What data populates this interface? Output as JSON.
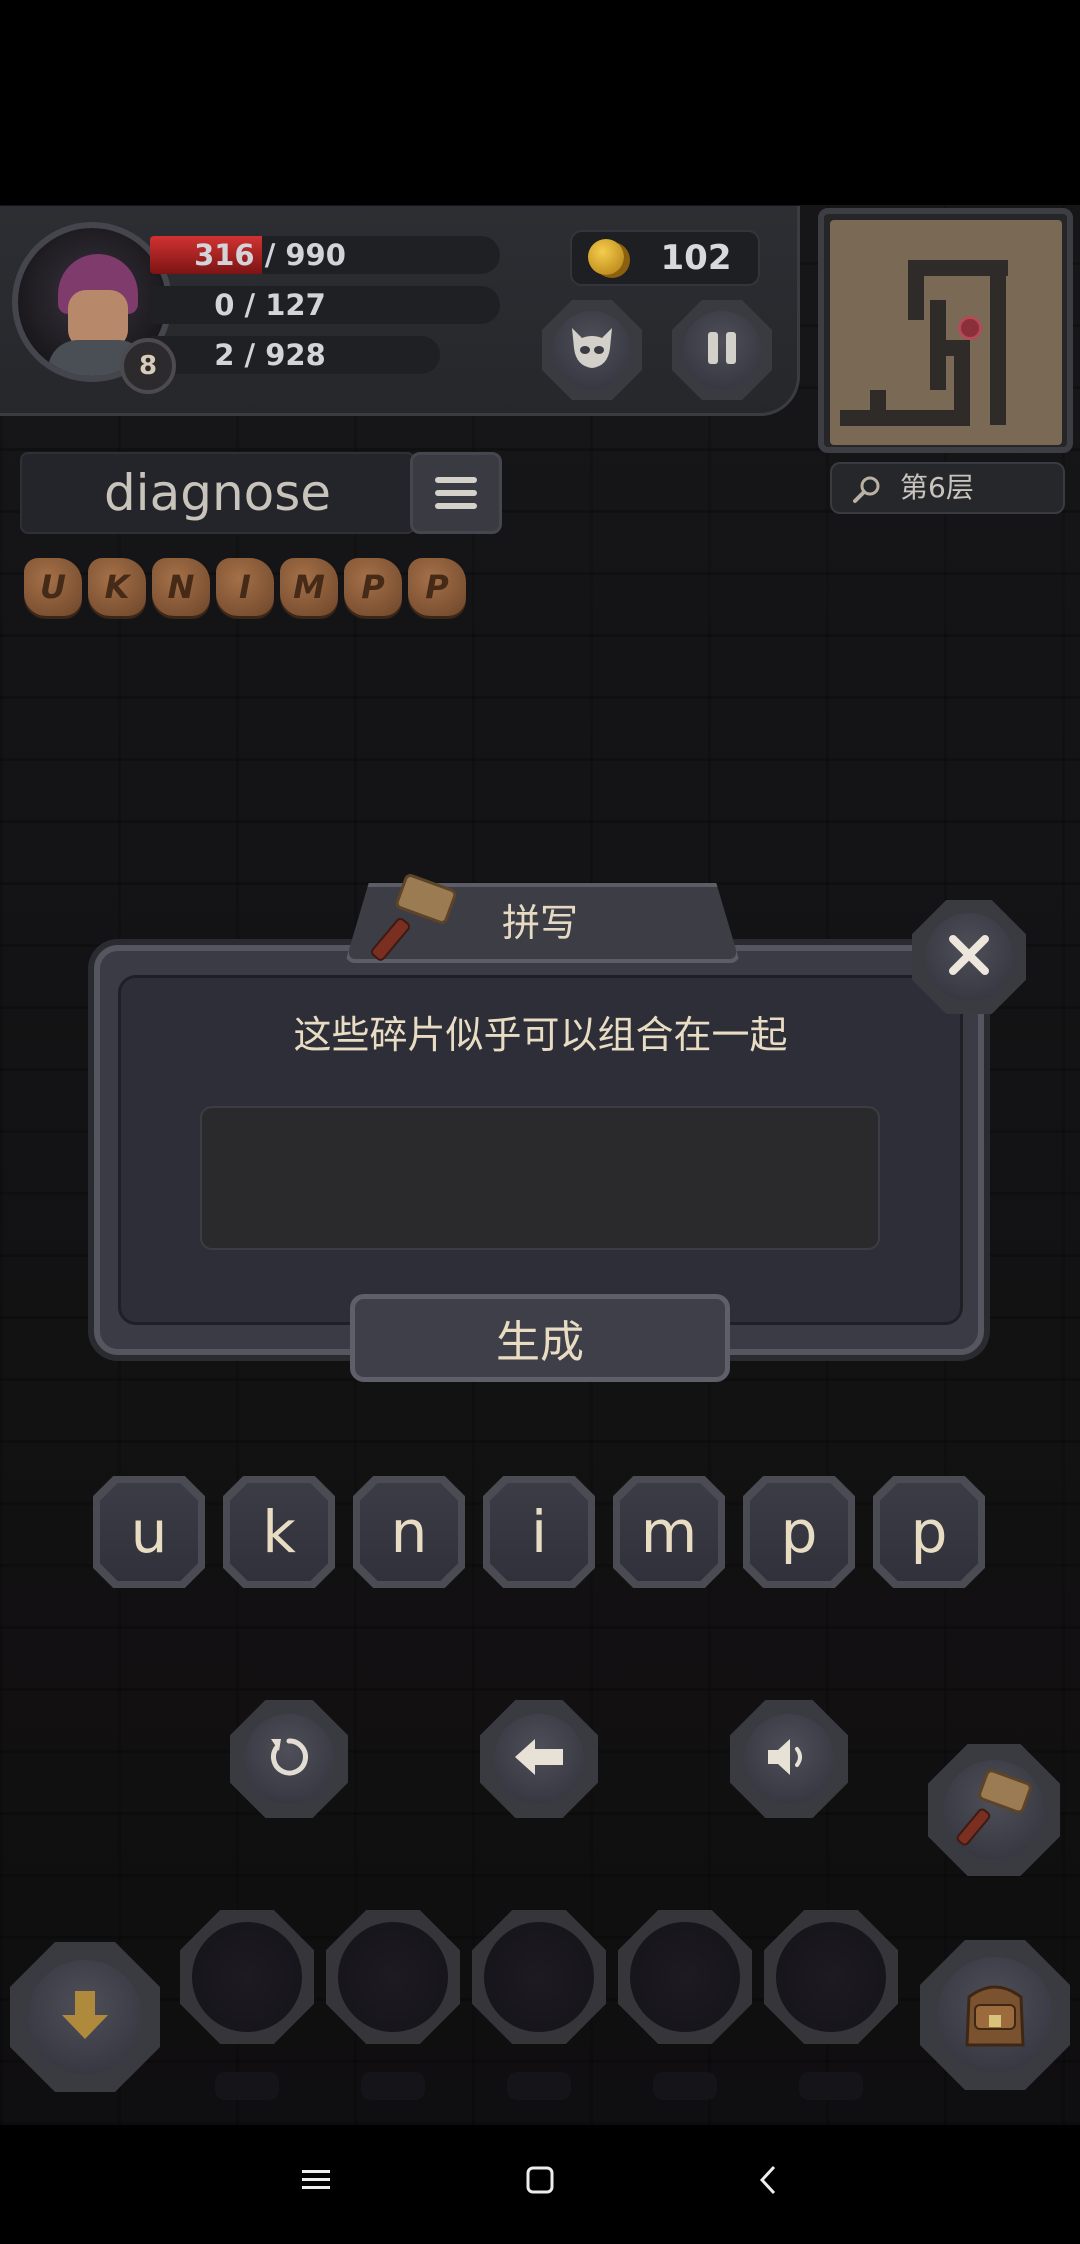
{
  "player": {
    "level": "8",
    "hp_text": "316 / 990",
    "hp_fraction": 0.319,
    "mp_text": "0 / 127",
    "xp_text": "2 / 928"
  },
  "gold": "102",
  "floor_label": "第6层",
  "current_word": "diagnose",
  "collected_tiles": [
    "U",
    "K",
    "N",
    "I",
    "M",
    "P",
    "P"
  ],
  "dialog": {
    "title": "拼写",
    "prompt": "这些碎片似乎可以组合在一起",
    "answer_value": "",
    "generate_label": "生成"
  },
  "letter_keys": [
    "u",
    "k",
    "n",
    "i",
    "m",
    "p",
    "p"
  ],
  "icons": {
    "monster": "monster-face-icon",
    "pause": "pause-icon",
    "search": "magnifier-icon",
    "menu": "list-menu-icon",
    "close": "close-x-icon",
    "reset": "reset-icon",
    "backspace": "arrow-left-icon",
    "sound": "speaker-icon",
    "hammer": "hammer-icon",
    "drop": "arrow-down-icon",
    "bag": "backpack-icon"
  },
  "colors": {
    "hp": "#c42a2a",
    "gold": "#e2b53a",
    "text_cream": "#e8dcc3"
  }
}
